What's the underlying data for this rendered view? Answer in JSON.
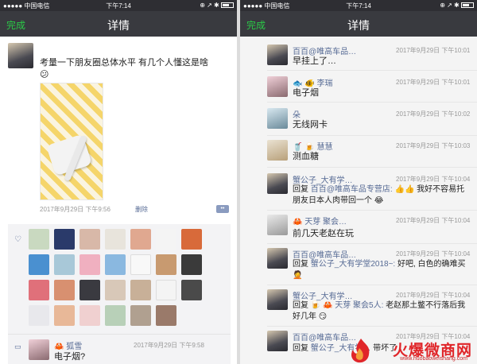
{
  "colors": {
    "accent": "#2bcc48",
    "link": "#576b95",
    "navbar": "#393a3f",
    "watermark": "#e0262a"
  },
  "left": {
    "status": {
      "carrier": "●●●●● 中国电信",
      "time": "下午7:14",
      "battery": "⊕ ↗ ✱"
    },
    "nav": {
      "done": "完成",
      "title": "详情"
    },
    "post": {
      "author": "",
      "text": "考量一下朋友圈总体水平 有几个人懂这是啥",
      "emoji": "😕",
      "time": "2017年9月29日 下午9:56",
      "delete": "删除"
    },
    "comment": {
      "name": "🦀 狐雪",
      "time": "2017年9月29日 下午9:58",
      "text": "电子烟?"
    }
  },
  "right": {
    "status": {
      "carrier": "●●●●● 中国电信",
      "time": "下午7:14",
      "battery": "⊕ ↗ ✱"
    },
    "nav": {
      "done": "完成",
      "title": "详情"
    },
    "comments": [
      {
        "name": "百百@唯高车品…",
        "time": "2017年9月29日 下午10:01",
        "text": "早挂上了…"
      },
      {
        "name": "🐟 🐠 李瑞",
        "time": "2017年9月29日 下午10:01",
        "text": "电子烟"
      },
      {
        "name": "朵",
        "time": "2017年9月29日 下午10:02",
        "text": "无线网卡"
      },
      {
        "name": "🥤 🍺 慧慧",
        "time": "2017年9月29日 下午10:03",
        "text": "测血糖"
      },
      {
        "name": "蟹公子_大有学…",
        "time": "2017年9月29日 下午10:04",
        "text_pre": "回复 ",
        "text_link": "百百@唯高车品专营店:",
        "text_post": " 👍👍 我好不容易托朋友日本人肉带回一个 😂"
      },
      {
        "name": "🦀 天芽 聚会…",
        "time": "2017年9月29日 下午10:04",
        "text": "前几天老赵在玩"
      },
      {
        "name": "百百@唯高车品…",
        "time": "2017年9月29日 下午10:04",
        "text_pre": "回复 ",
        "text_link": "蟹公子_大有学堂2018~:",
        "text_post": " 好吧, 白色的确难买 🤦"
      },
      {
        "name": "蟹公子_大有学…",
        "time": "2017年9月29日 下午10:04",
        "text_pre": "回复 ",
        "text_link": "🍺 🦀 天芽 聚会5人:",
        "text_post": " 老赵那土鳖不行落后我好几年 😏"
      },
      {
        "name": "百百@唯高车品…",
        "time": "2017年9月29日 下午10:04",
        "text_pre": "回复 ",
        "text_link": "蟹公子_大有学…",
        "text_post": " 带坏了"
      }
    ]
  },
  "watermark": {
    "main": "火爆微商网",
    "sub": "www.huobaoweishang.com"
  }
}
